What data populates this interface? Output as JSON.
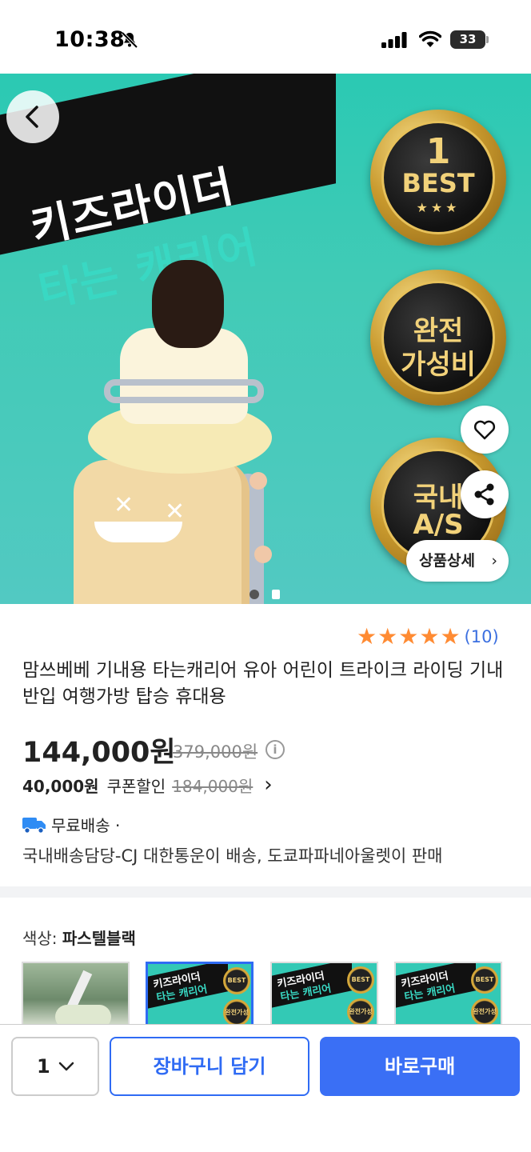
{
  "status_bar": {
    "time": "10:38",
    "battery": "33"
  },
  "hero": {
    "headline_line1": "키즈라이더",
    "headline_line2": "타는 캐리어",
    "badge1": {
      "number": "1",
      "word": "BEST",
      "stars": "★★★"
    },
    "badge2": {
      "line1": "완전",
      "line2": "가성비"
    },
    "badge3": {
      "line1": "국내",
      "line2": "A/S"
    },
    "detail_button": "상품상세",
    "detail_chevron": "›",
    "carousel": {
      "count": 2,
      "active_index": 0
    }
  },
  "product": {
    "rating": {
      "stars": 5,
      "count": "(10)"
    },
    "title": "맘쓰베베 기내용 타는캐리어 유아 어린이 트라이크 라이딩 기내반입 여행가방 탑승 휴대용",
    "price": "144,000원",
    "original_price": "379,000원",
    "info_glyph": "i",
    "coupon": {
      "amount": "40,000원",
      "label": "쿠폰할인",
      "original": "184,000원",
      "chevron": "›"
    },
    "shipping": {
      "label": "무료배송 ·",
      "detail": "국내배송담당-CJ 대한통운이 배송, 도쿄파파네아울렛이 판매"
    }
  },
  "options": {
    "color_label": "색상: ",
    "color_value": "파스텔블랙",
    "thumb_text1": "키즈라이더",
    "thumb_text2": "타는 캐리어",
    "thumb_badge1": "BEST",
    "thumb_badge2": "완전가성비"
  },
  "bottom_bar": {
    "quantity": "1",
    "cart_button": "장바구니 담기",
    "buy_button": "바로구매"
  },
  "colors": {
    "accent": "#3a6ff5",
    "star": "#ff8b33",
    "rating_count": "#3b6fe0"
  }
}
